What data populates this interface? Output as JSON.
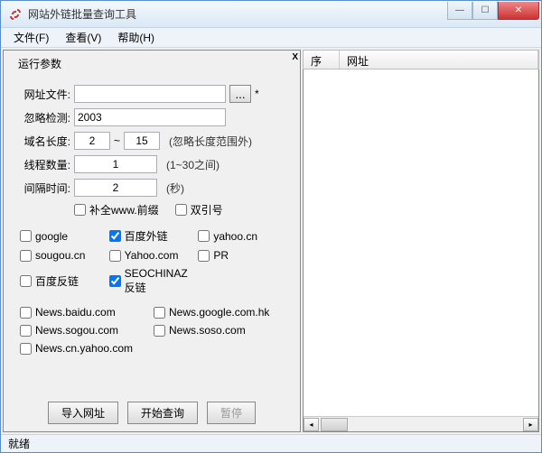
{
  "window": {
    "title": "网站外链批量查询工具"
  },
  "menu": {
    "file": "文件(F)",
    "view": "查看(V)",
    "help": "帮助(H)"
  },
  "panel": {
    "legend": "运行参数",
    "close_mark": "X",
    "url_file_label": "网址文件:",
    "url_file_value": "",
    "url_file_star": "*",
    "ignore_label": "忽略检测:",
    "ignore_value": "2003",
    "domain_len_label": "域名长度:",
    "domain_min": "2",
    "domain_tilde": "~",
    "domain_max": "15",
    "domain_note": "(忽略长度范围外)",
    "threads_label": "线程数量:",
    "threads_value": "1",
    "threads_note": "(1~30之间)",
    "interval_label": "间隔时间:",
    "interval_value": "2",
    "interval_note": "(秒)",
    "chk_www": "补全www.前缀",
    "chk_quote": "双引号"
  },
  "engines": {
    "google": "google",
    "baidu_out": "百度外链",
    "yahoo_cn": "yahoo.cn",
    "sougou_cn": "sougou.cn",
    "yahoo_com": "Yahoo.com",
    "pr": "PR",
    "baidu_back": "百度反链",
    "seochinaz": "SEOCHINAZ反链"
  },
  "news": {
    "baidu": "News.baidu.com",
    "google_hk": "News.google.com.hk",
    "sogou": "News.sogou.com",
    "soso": "News.soso.com",
    "cn_yahoo": "News.cn.yahoo.com"
  },
  "buttons": {
    "import": "导入网址",
    "start": "开始查询",
    "pause": "暂停"
  },
  "list": {
    "col_index": "序号",
    "col_url": "网址"
  },
  "status": {
    "text": "就绪"
  },
  "checked": {
    "baidu_out": true,
    "seochinaz": true
  }
}
